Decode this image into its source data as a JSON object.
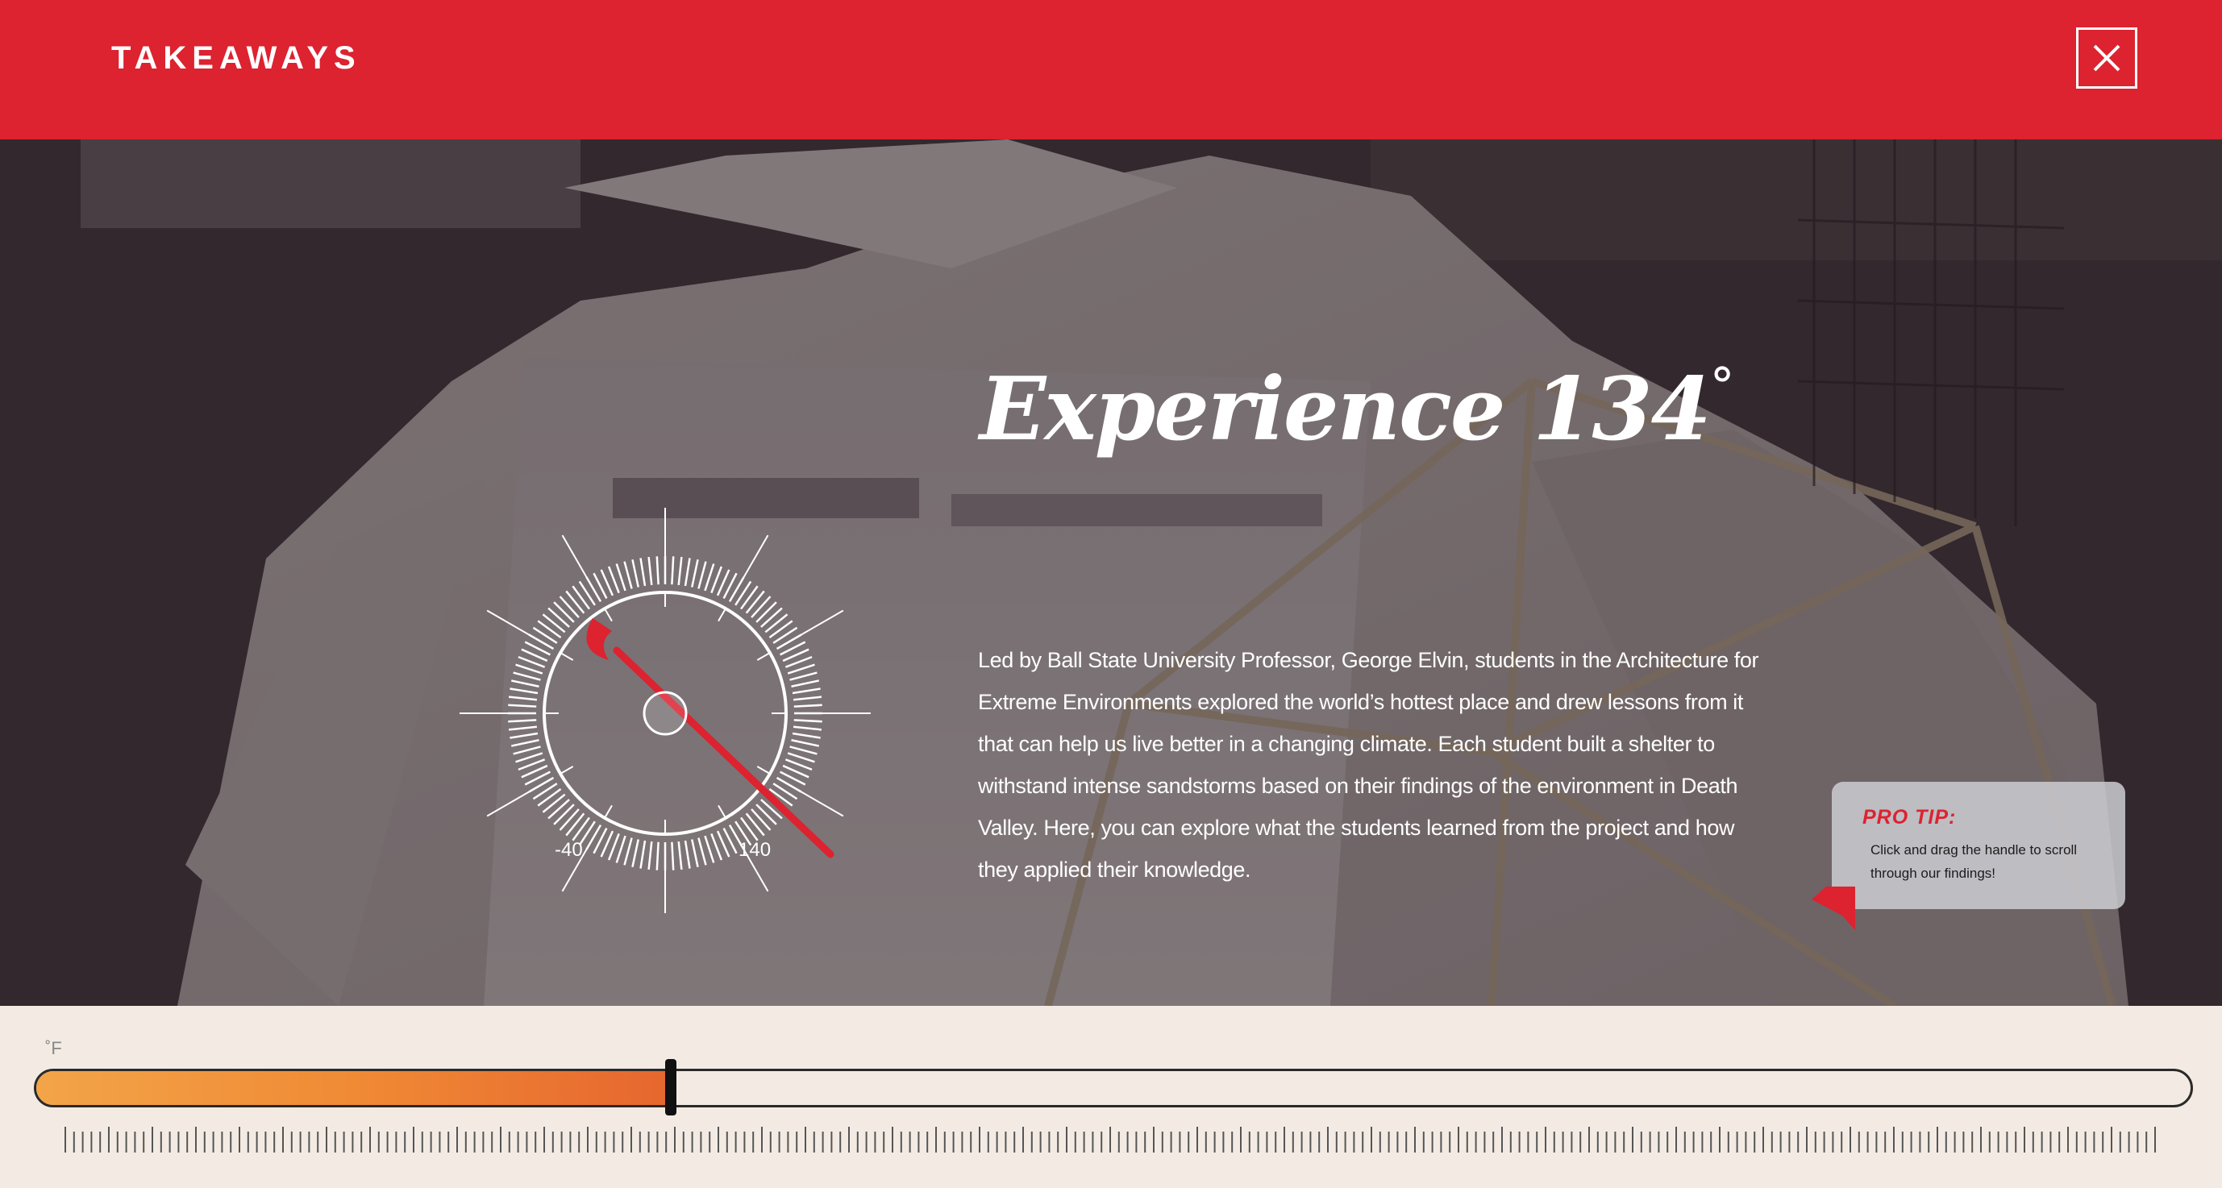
{
  "header": {
    "title": "TAKEAWAYS",
    "close_icon": "close-icon"
  },
  "hero": {
    "headline": "Experience 134",
    "degree": "°",
    "description": "Led by Ball State University Professor, George Elvin, students in the Architecture for Extreme Environments explored the world’s hottest place and drew lessons from it that can help us live better in a changing climate. Each student built a shelter to withstand intense sandstorms based on their findings of the environment in Death Valley. Here, you can explore what the students learned from the project and how they applied their knowledge.",
    "gauge": {
      "min_label": "-40",
      "max_label": "140",
      "min": -40,
      "max": 140,
      "value": 134
    }
  },
  "protip": {
    "title": "PRO TIP:",
    "text": "Click and drag the handle to scroll through our findings!"
  },
  "slider": {
    "unit": "˚F",
    "progress": 0.295
  },
  "colors": {
    "brand_red": "#dd2230",
    "slider_fill_start": "#f3a449",
    "slider_fill_end": "#e6662f",
    "footer_bg": "#f3ebe3"
  }
}
